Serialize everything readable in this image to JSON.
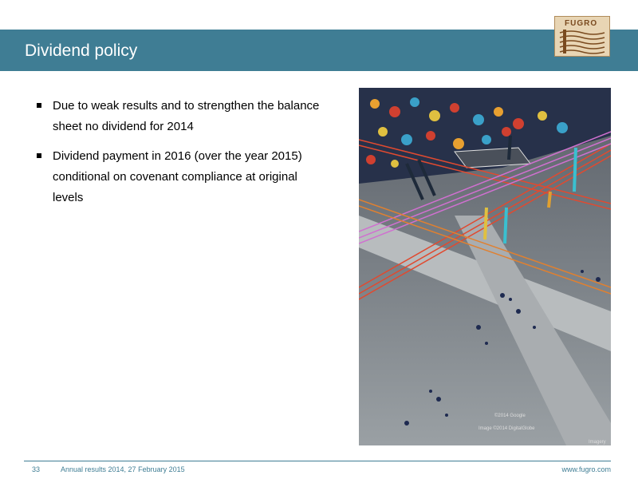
{
  "title": "Dividend policy",
  "logo": {
    "text": "FUGRO"
  },
  "bullets": [
    {
      "text": "Due to weak results and to strengthen the balance sheet no dividend for 2014"
    },
    {
      "text": "Dividend payment in 2016 (over the year 2015) conditional on covenant compliance at original levels"
    }
  ],
  "image": {
    "watermarks": [
      "©2014 Google",
      "Image ©2014 DigitalGlobe",
      "Imagery"
    ]
  },
  "footer": {
    "page_number": "33",
    "caption": "Annual results 2014, 27 February 2015",
    "url": "www.fugro.com"
  },
  "colors": {
    "accent": "#3f7d94",
    "logo_bg": "#e8d5b4",
    "logo_text": "#7a4a1e"
  }
}
